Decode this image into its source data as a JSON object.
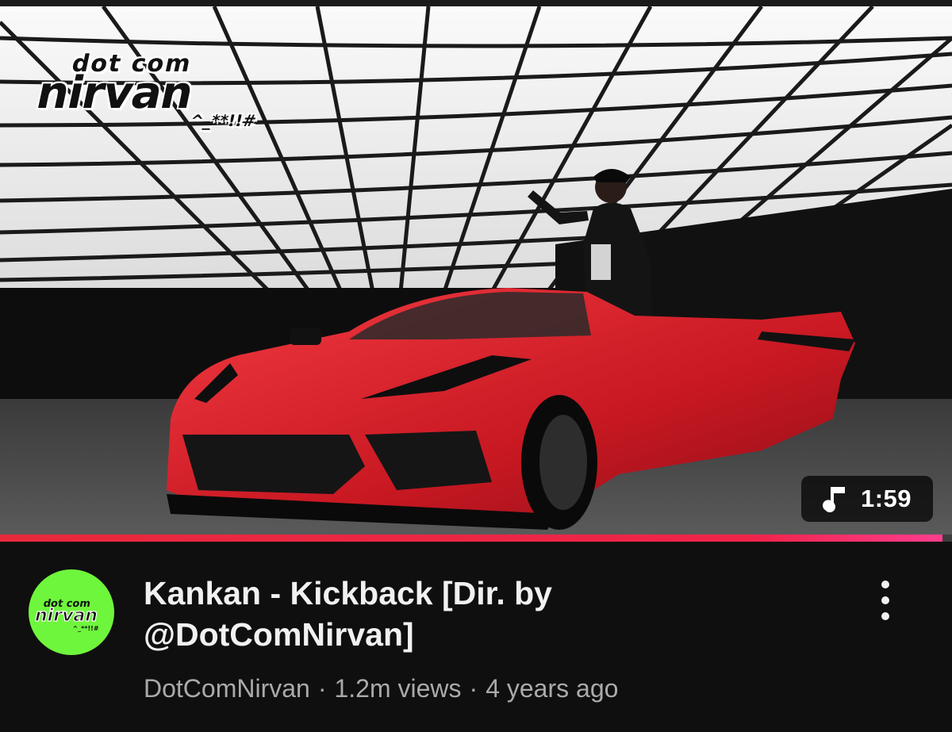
{
  "video": {
    "thumbnail_icon": "music-note-icon",
    "watermark": {
      "top": "dot com",
      "main": "nirvan",
      "sub": "^_**!!#"
    },
    "duration": "1:59",
    "progress_fraction": 0.99,
    "title": "Kankan - Kickback [Dir. by @DotComNirvan]",
    "channel": "DotComNirvan",
    "views": "1.2m views",
    "age": "4 years ago",
    "separator": "·"
  },
  "colors": {
    "background": "#0f0f0f",
    "progress_red": "#f0244a",
    "avatar_green": "#6ef63c",
    "meta_gray": "#aaaaaa",
    "car_red": "#d8202c"
  },
  "menu": {
    "icon": "more-vertical-icon"
  }
}
